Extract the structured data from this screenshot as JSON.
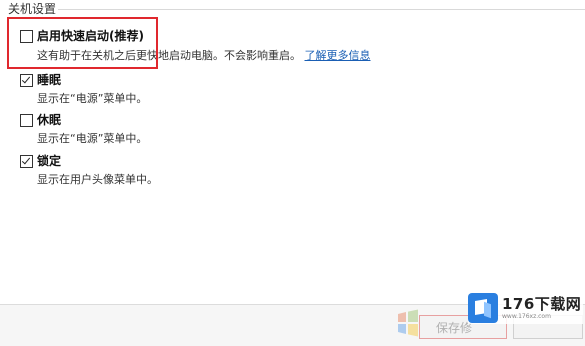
{
  "section": {
    "title": "关机设置"
  },
  "options": [
    {
      "label": "启用快速启动(推荐)",
      "checked": false,
      "desc": "这有助于在关机之后更快地启动电脑。不会影响重启。",
      "link": "了解更多信息"
    },
    {
      "label": "睡眠",
      "checked": true,
      "desc": "显示在“电源”菜单中。"
    },
    {
      "label": "休眠",
      "checked": false,
      "desc": "显示在“电源”菜单中。"
    },
    {
      "label": "锁定",
      "checked": true,
      "desc": "显示在用户头像菜单中。"
    }
  ],
  "footer": {
    "save_label": "保存修",
    "cancel_label": ""
  },
  "watermark": {
    "main": "176下载网",
    "sub": "www.176xz.com"
  },
  "colors": {
    "highlight": "#e0282e",
    "link": "#1a5fb4",
    "watermark_logo": "#2a7fe0"
  }
}
